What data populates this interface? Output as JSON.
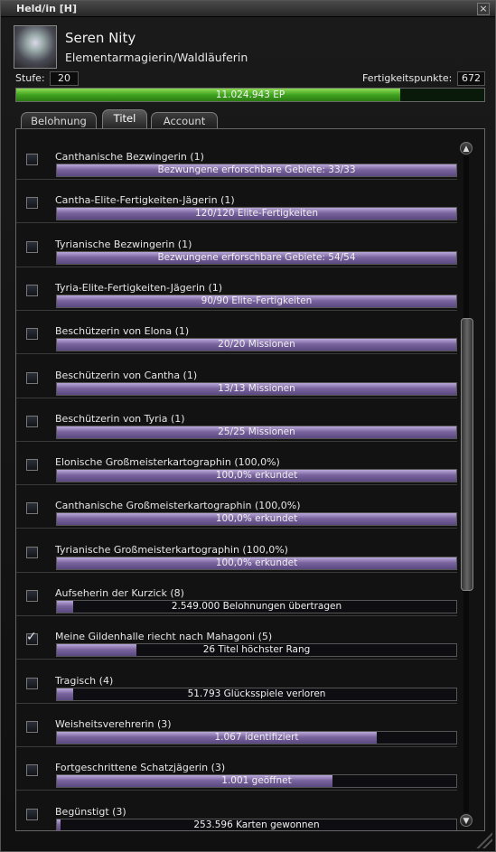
{
  "window": {
    "title": "Held/in  [H]",
    "close_icon": "close-icon"
  },
  "character": {
    "name": "Seren Nity",
    "profession": "Elementarmagierin/Waldläuferin"
  },
  "stats": {
    "level_label": "Stufe:",
    "level_value": "20",
    "skillpoints_label": "Fertigkeitspunkte:",
    "skillpoints_value": "672"
  },
  "xp": {
    "text": "11.024.943 EP",
    "fraction": 0.82
  },
  "tabs": [
    {
      "label": "Belohnung",
      "active": false
    },
    {
      "label": "Titel",
      "active": true
    },
    {
      "label": "Account",
      "active": false
    }
  ],
  "titles": [
    {
      "title": "Canthanische Bezwingerin (1)",
      "progress": "Bezwungene erforschbare Gebiete: 33/33",
      "fraction": 1.0,
      "checked": false
    },
    {
      "title": "Cantha-Elite-Fertigkeiten-Jägerin (1)",
      "progress": "120/120 Elite-Fertigkeiten",
      "fraction": 1.0,
      "checked": false
    },
    {
      "title": "Tyrianische Bezwingerin (1)",
      "progress": "Bezwungene erforschbare Gebiete: 54/54",
      "fraction": 1.0,
      "checked": false
    },
    {
      "title": "Tyria-Elite-Fertigkeiten-Jägerin (1)",
      "progress": "90/90 Elite-Fertigkeiten",
      "fraction": 1.0,
      "checked": false
    },
    {
      "title": "Beschützerin von Elona (1)",
      "progress": "20/20 Missionen",
      "fraction": 1.0,
      "checked": false
    },
    {
      "title": "Beschützerin von Cantha (1)",
      "progress": "13/13 Missionen",
      "fraction": 1.0,
      "checked": false
    },
    {
      "title": "Beschützerin von Tyria (1)",
      "progress": "25/25 Missionen",
      "fraction": 1.0,
      "checked": false
    },
    {
      "title": "Elonische Großmeisterkartographin (100,0%)",
      "progress": "100,0% erkundet",
      "fraction": 1.0,
      "checked": false
    },
    {
      "title": "Canthanische Großmeisterkartographin (100,0%)",
      "progress": "100,0% erkundet",
      "fraction": 1.0,
      "checked": false
    },
    {
      "title": "Tyrianische Großmeisterkartographin (100,0%)",
      "progress": "100,0% erkundet",
      "fraction": 1.0,
      "checked": false
    },
    {
      "title": "Aufseherin der Kurzick (8)",
      "progress": "2.549.000 Belohnungen übertragen",
      "fraction": 0.04,
      "checked": false
    },
    {
      "title": "Meine Gildenhalle riecht nach Mahagoni (5)",
      "progress": "26 Titel höchster Rang",
      "fraction": 0.2,
      "checked": true
    },
    {
      "title": "Tragisch (4)",
      "progress": "51.793 Glücksspiele verloren",
      "fraction": 0.04,
      "checked": false
    },
    {
      "title": "Weisheitsverehrerin (3)",
      "progress": "1.067 identifiziert",
      "fraction": 0.8,
      "checked": false
    },
    {
      "title": "Fortgeschrittene Schatzjägerin (3)",
      "progress": "1.001 geöffnet",
      "fraction": 0.69,
      "checked": false
    },
    {
      "title": "Begünstigt (3)",
      "progress": "253.596 Karten gewonnen",
      "fraction": 0.01,
      "checked": false
    }
  ],
  "scrollbar": {
    "up_icon": "scroll-up-icon",
    "down_icon": "scroll-down-icon",
    "position": 0.42
  }
}
